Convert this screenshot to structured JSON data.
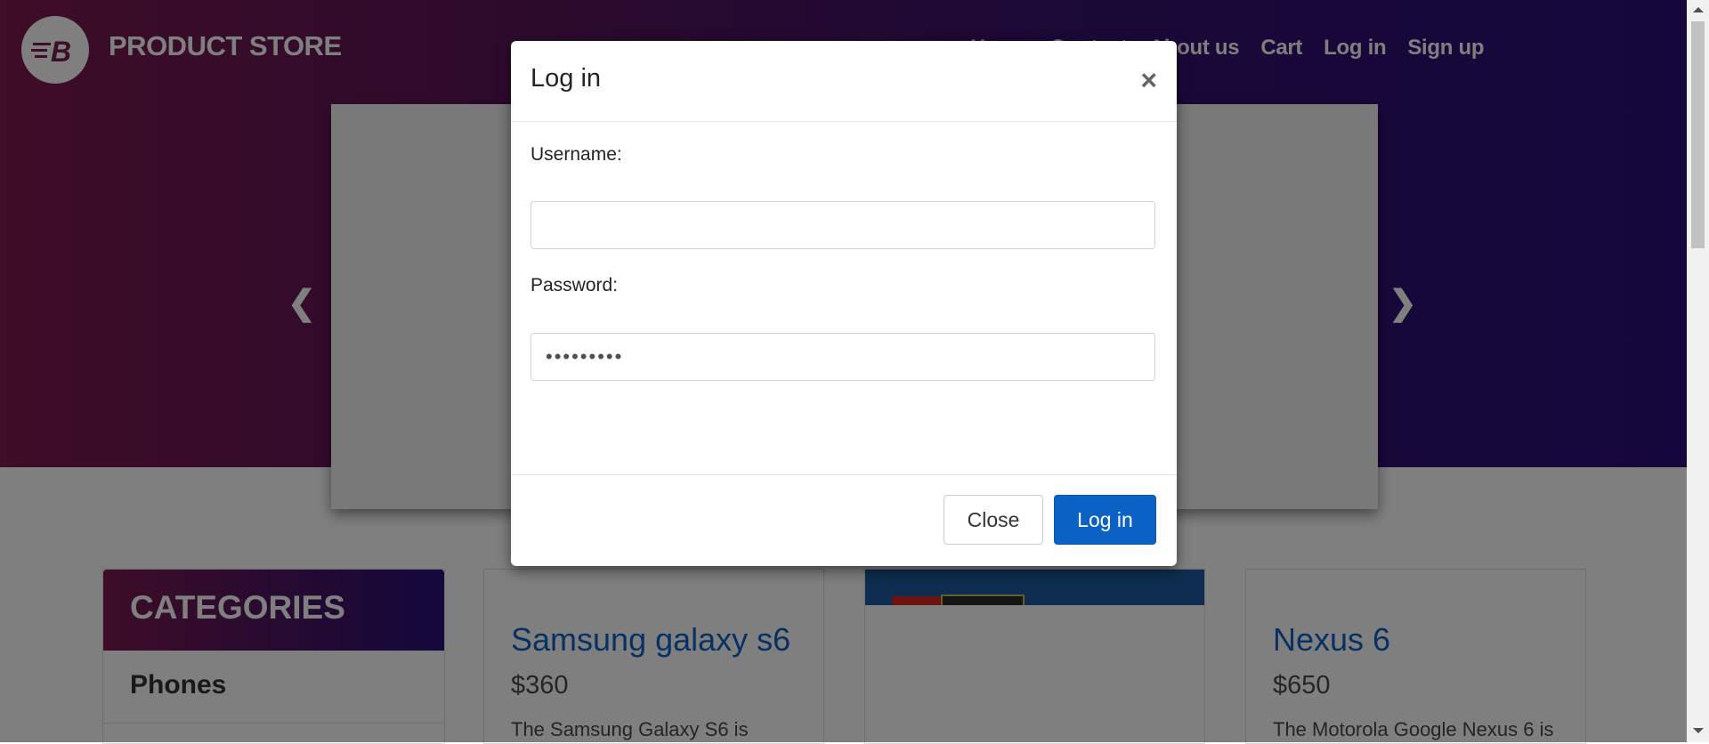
{
  "header": {
    "brand": "PRODUCT STORE",
    "logo_icon": "brand-logo-icon",
    "nav": [
      "Home",
      "Contact",
      "About us",
      "Cart",
      "Log in",
      "Sign up"
    ]
  },
  "carousel": {
    "prev_icon": "chevron-left-icon",
    "next_icon": "chevron-right-icon"
  },
  "categories": {
    "title": "CATEGORIES",
    "items": [
      "Phones"
    ]
  },
  "products": [
    {
      "title": "Samsung galaxy s6",
      "price": "$360",
      "desc": "The Samsung Galaxy S6 is"
    },
    {
      "title": "",
      "price": "",
      "desc": ""
    },
    {
      "title": "Nexus 6",
      "price": "$650",
      "desc": "The Motorola Google Nexus 6 is"
    }
  ],
  "modal": {
    "title": "Log in",
    "close_icon": "close-icon",
    "username_label": "Username:",
    "username_value": "",
    "password_label": "Password:",
    "password_value": "•••••••••",
    "close_button": "Close",
    "login_button": "Log in"
  },
  "colors": {
    "accent_blue": "#0b62c4",
    "link_blue": "#0e63c4",
    "hero_start": "#7c1a4f",
    "hero_end": "#2a0f7a"
  }
}
